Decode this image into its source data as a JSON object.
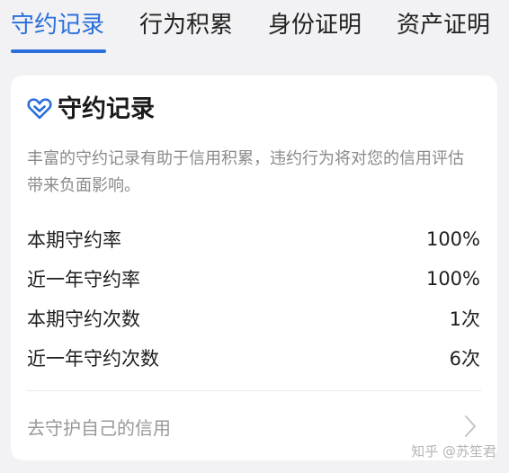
{
  "tabs": [
    {
      "label": "守约记录",
      "active": true
    },
    {
      "label": "行为积累",
      "active": false
    },
    {
      "label": "身份证明",
      "active": false
    },
    {
      "label": "资产证明",
      "active": false
    }
  ],
  "card": {
    "icon": "heart-icon",
    "title": "守约记录",
    "description": "丰富的守约记录有助于信用积累，违约行为将对您的信用评估带来负面影响。",
    "stats": [
      {
        "label": "本期守约率",
        "value": "100%"
      },
      {
        "label": "近一年守约率",
        "value": "100%"
      },
      {
        "label": "本期守约次数",
        "value": "1次"
      },
      {
        "label": "近一年守约次数",
        "value": "6次"
      }
    ],
    "footer_link": "去守护自己的信用"
  },
  "watermark": "知乎 @苏笙君",
  "colors": {
    "accent": "#2a6fdb",
    "background": "#f2f2f4",
    "card": "#ffffff",
    "muted_text": "#8a8a8a"
  }
}
